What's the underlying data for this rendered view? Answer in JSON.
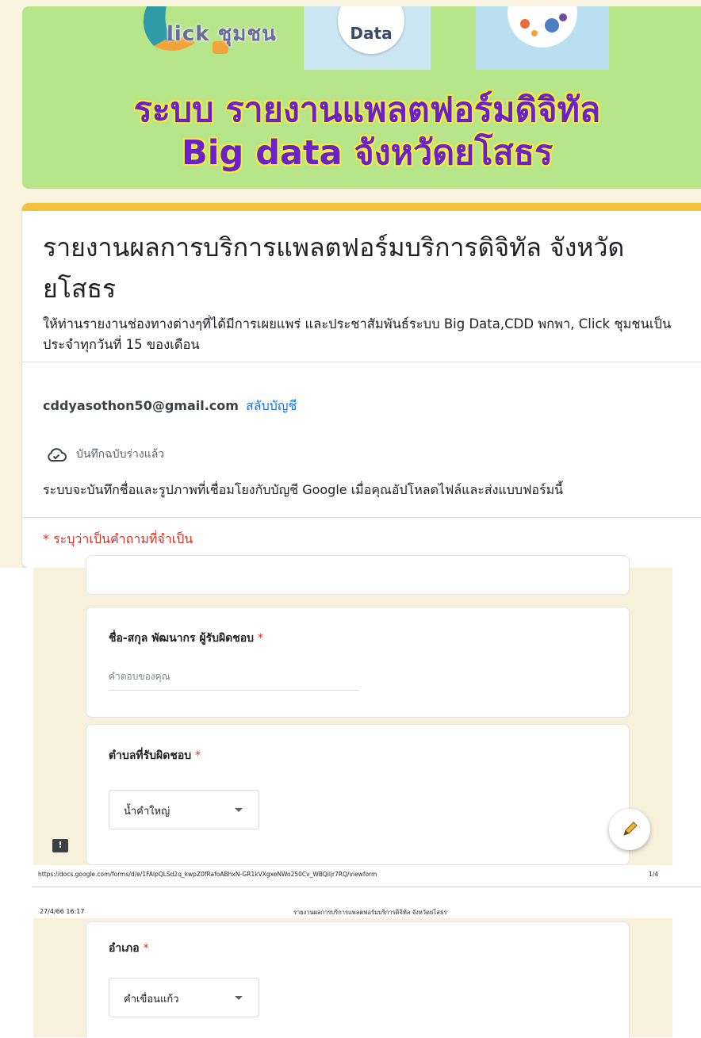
{
  "banner": {
    "logo_text": "lick ชุมชน",
    "data_label": "Data",
    "title_line1": "ระบบ รายงานแพลตฟอร์มดิจิทัล",
    "title_line2": "Big data จังหวัดยโสธร"
  },
  "form": {
    "title": "รายงานผลการบริการแพลตฟอร์มบริการดิจิทัล จังหวัดยโสธร",
    "description": "ให้ท่านรายงานช่องทางต่างๆที่ได้มีการเผยแพร่ และประชาสัมพันธ์ระบบ Big Data,CDD พกพา, Click ชุมชนเป็นประจำทุกวันที่ 15 ของเดือน",
    "account_email": "cddyasothon50@gmail.com",
    "switch_account": "สลับบัญชี",
    "draft_saved": "บันทึกฉบับร่างแล้ว",
    "privacy_note": "ระบบจะบันทึกชื่อและรูปภาพที่เชื่อมโยงกับบัญชี Google เมื่อคุณอัปโหลดไฟล์และส่งแบบฟอร์มนี้",
    "required_note": "* ระบุว่าเป็นคำถามที่จำเป็น"
  },
  "questions": {
    "name": {
      "label": "ชื่อ-สกุล พัฒนากร ผู้รับผิดชอบ",
      "required_mark": "*",
      "placeholder": "คำตอบของคุณ"
    },
    "subdistrict": {
      "label": "ตำบลที่รับผิดชอบ",
      "required_mark": "*",
      "selected": "น้ำคำใหญ่"
    },
    "district": {
      "label": "อำเภอ",
      "required_mark": "*",
      "selected": "คำเขื่อนแก้ว"
    }
  },
  "print": {
    "url": "https://docs.google.com/forms/d/e/1FAIpQLSd2q_kwpZ0fRafoABhxN-GR1kVXgxeNWo250Cv_WBQiljr7RQ/viewform",
    "page_number": "1/4",
    "date": "27/4/66 16:17",
    "header_title": "รายงานผลการบริการแพลตฟอร์มบริการดิจิทัล จังหวัดยโสธร"
  },
  "icons": {
    "draft": "cloud-check-icon",
    "feedback": "feedback-icon",
    "edit": "pencil-icon",
    "dropdown": "dropdown-arrow-icon"
  },
  "colors": {
    "banner_bg": "#b6e58a",
    "banner_title": "#6b21c8",
    "banner_title_outline": "#f2ea3c",
    "accent": "#f3c23d",
    "link": "#1a73e8",
    "required": "#d93025",
    "page_bg": "#faf3e0"
  }
}
